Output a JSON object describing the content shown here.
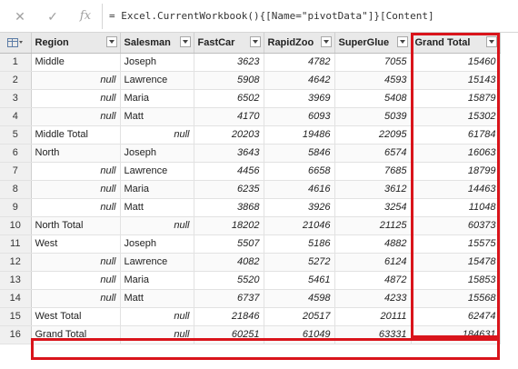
{
  "formula_bar": {
    "cancel_icon": "✕",
    "confirm_icon": "✓",
    "fx_icon": "fx",
    "formula": "= Excel.CurrentWorkbook(){[Name=\"pivotData\"]}[Content]"
  },
  "columns": [
    "Region",
    "Salesman",
    "FastCar",
    "RapidZoo",
    "SuperGlue",
    "Grand Total"
  ],
  "rows": [
    {
      "idx": "1",
      "region": "Middle",
      "salesman": "Joseph",
      "fastcar": "3623",
      "rapidzoo": "4782",
      "superglue": "7055",
      "total": "15460"
    },
    {
      "idx": "2",
      "region": "null",
      "salesman": "Lawrence",
      "fastcar": "5908",
      "rapidzoo": "4642",
      "superglue": "4593",
      "total": "15143"
    },
    {
      "idx": "3",
      "region": "null",
      "salesman": "Maria",
      "fastcar": "6502",
      "rapidzoo": "3969",
      "superglue": "5408",
      "total": "15879"
    },
    {
      "idx": "4",
      "region": "null",
      "salesman": "Matt",
      "fastcar": "4170",
      "rapidzoo": "6093",
      "superglue": "5039",
      "total": "15302"
    },
    {
      "idx": "5",
      "region": "Middle Total",
      "salesman": "null",
      "fastcar": "20203",
      "rapidzoo": "19486",
      "superglue": "22095",
      "total": "61784"
    },
    {
      "idx": "6",
      "region": "North",
      "salesman": "Joseph",
      "fastcar": "3643",
      "rapidzoo": "5846",
      "superglue": "6574",
      "total": "16063"
    },
    {
      "idx": "7",
      "region": "null",
      "salesman": "Lawrence",
      "fastcar": "4456",
      "rapidzoo": "6658",
      "superglue": "7685",
      "total": "18799"
    },
    {
      "idx": "8",
      "region": "null",
      "salesman": "Maria",
      "fastcar": "6235",
      "rapidzoo": "4616",
      "superglue": "3612",
      "total": "14463"
    },
    {
      "idx": "9",
      "region": "null",
      "salesman": "Matt",
      "fastcar": "3868",
      "rapidzoo": "3926",
      "superglue": "3254",
      "total": "11048"
    },
    {
      "idx": "10",
      "region": "North Total",
      "salesman": "null",
      "fastcar": "18202",
      "rapidzoo": "21046",
      "superglue": "21125",
      "total": "60373"
    },
    {
      "idx": "11",
      "region": "West",
      "salesman": "Joseph",
      "fastcar": "5507",
      "rapidzoo": "5186",
      "superglue": "4882",
      "total": "15575"
    },
    {
      "idx": "12",
      "region": "null",
      "salesman": "Lawrence",
      "fastcar": "4082",
      "rapidzoo": "5272",
      "superglue": "6124",
      "total": "15478"
    },
    {
      "idx": "13",
      "region": "null",
      "salesman": "Maria",
      "fastcar": "5520",
      "rapidzoo": "5461",
      "superglue": "4872",
      "total": "15853"
    },
    {
      "idx": "14",
      "region": "null",
      "salesman": "Matt",
      "fastcar": "6737",
      "rapidzoo": "4598",
      "superglue": "4233",
      "total": "15568"
    },
    {
      "idx": "15",
      "region": "West Total",
      "salesman": "null",
      "fastcar": "21846",
      "rapidzoo": "20517",
      "superglue": "20111",
      "total": "62474"
    },
    {
      "idx": "16",
      "region": "Grand Total",
      "salesman": "null",
      "fastcar": "60251",
      "rapidzoo": "61049",
      "superglue": "63331",
      "total": "184631"
    }
  ],
  "colors": {
    "highlight": "#d9141b",
    "header_bg": "#e9e9e9"
  }
}
